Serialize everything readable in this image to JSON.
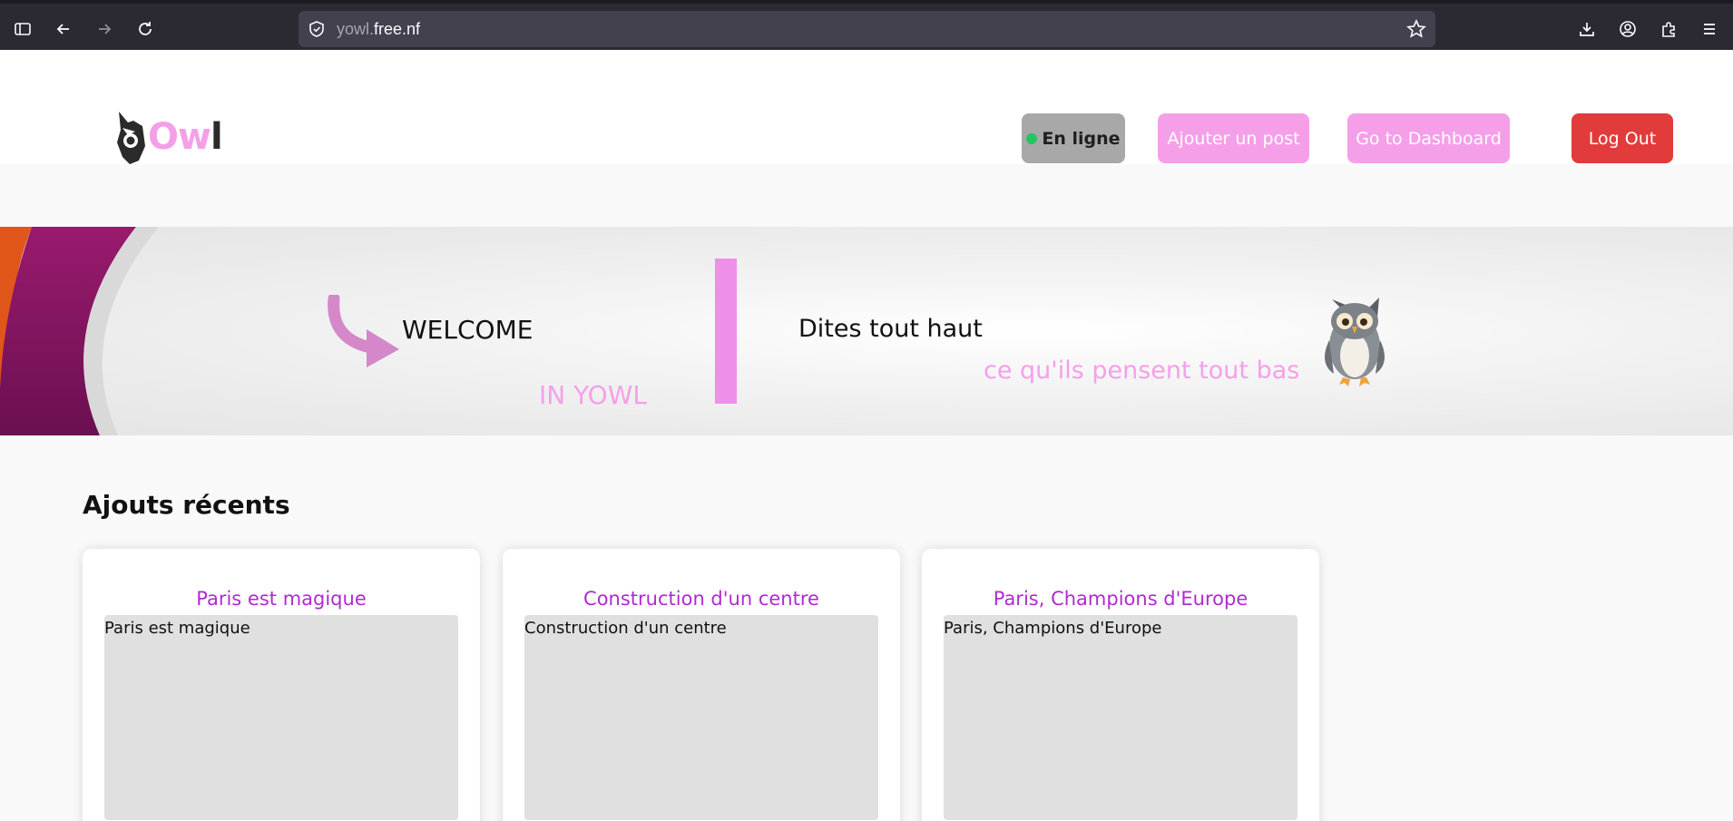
{
  "browser": {
    "url_prefix": "yowl.",
    "url_domain": "free.nf",
    "icons": [
      "sidebar-icon",
      "back-icon",
      "forward-icon",
      "reload-icon",
      "shield-icon",
      "star-icon",
      "download-icon",
      "account-icon",
      "extensions-icon",
      "menu-icon"
    ]
  },
  "header": {
    "logo": {
      "o": "O",
      "w": "w",
      "l": "l"
    },
    "status_label": "En ligne",
    "add_post_label": "Ajouter un post",
    "dashboard_label": "Go to Dashboard",
    "logout_label": "Log Out",
    "colors": {
      "pink": "#f59fe9",
      "logout": "#e23b3b",
      "status_bg": "#a8a8a8",
      "online_dot": "#22c55e"
    }
  },
  "hero": {
    "welcome": "WELCOME",
    "in_yowl": "IN YOWL",
    "tagline_1": "Dites tout haut",
    "tagline_2": "ce qu'ils pensent tout bas"
  },
  "recent": {
    "title": "Ajouts récents",
    "posts": [
      {
        "title": "Paris est magique",
        "content": "Paris est magique"
      },
      {
        "title": "Construction d'un centre",
        "content": "Construction d'un centre"
      },
      {
        "title": "Paris, Champions d'Europe",
        "content": "Paris, Champions d'Europe"
      }
    ],
    "title_color": "#b02bd0"
  }
}
